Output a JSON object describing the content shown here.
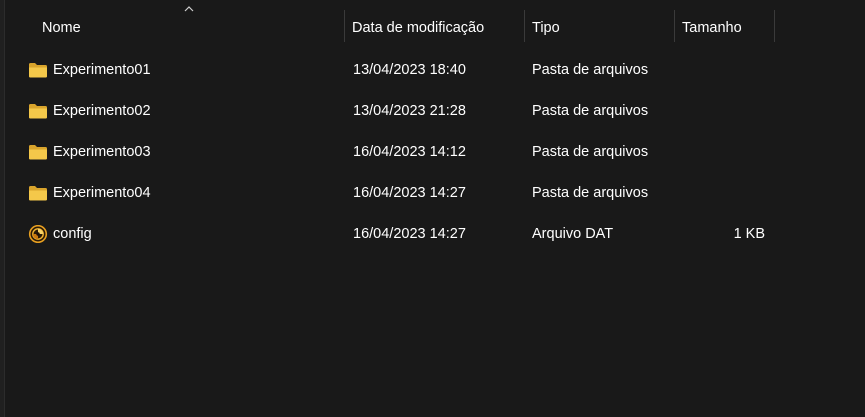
{
  "columns": {
    "name": "Nome",
    "date": "Data de modificação",
    "type": "Tipo",
    "size": "Tamanho"
  },
  "sort": {
    "column": "name",
    "icon": "chevron-up-icon"
  },
  "files": [
    {
      "name": "Experimento01",
      "date": "13/04/2023 18:40",
      "type": "Pasta de arquivos",
      "size": "",
      "icon": "folder-icon"
    },
    {
      "name": "Experimento02",
      "date": "13/04/2023 21:28",
      "type": "Pasta de arquivos",
      "size": "",
      "icon": "folder-icon"
    },
    {
      "name": "Experimento03",
      "date": "16/04/2023 14:12",
      "type": "Pasta de arquivos",
      "size": "",
      "icon": "folder-icon"
    },
    {
      "name": "Experimento04",
      "date": "16/04/2023 14:27",
      "type": "Pasta de arquivos",
      "size": "",
      "icon": "folder-icon"
    },
    {
      "name": "config",
      "date": "16/04/2023 14:27",
      "type": "Arquivo DAT",
      "size": "1 KB",
      "icon": "dat-file-icon"
    }
  ],
  "colors": {
    "background": "#191919",
    "folder": "#f4c84a",
    "folder_dark": "#d9a42c",
    "text": "#ffffff",
    "separator": "#3a3a3a"
  }
}
